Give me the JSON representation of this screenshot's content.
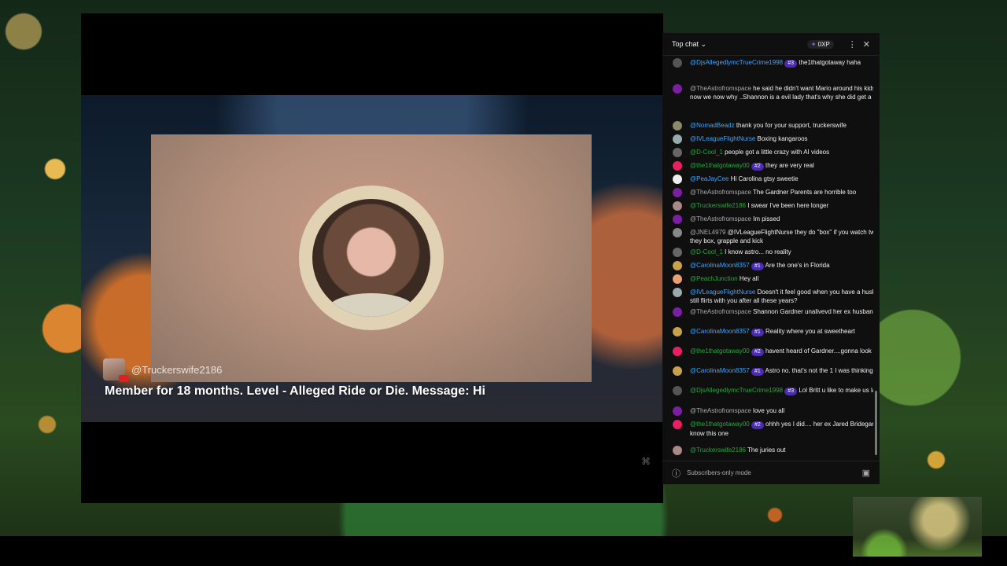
{
  "stream": {
    "member_handle": "@Truckerswife2186",
    "member_message": "Member for 18 months. Level - Alleged Ride or Die. Message: Hi"
  },
  "chat": {
    "header": {
      "title": "Top chat",
      "xp": "0XP"
    },
    "footer": {
      "mode": "Subscribers-only mode"
    },
    "messages": [
      {
        "author": "@DjsAllegedlymcTrueCrime1998",
        "badge": "#3",
        "text": "the1thatgotaway haha",
        "color": "#3ea6ff",
        "av": "#555"
      },
      {
        "author": "@TheAstrofromspace",
        "badge": "",
        "text": "he said he didn't want Mario around his kids and now we now why ..Shannon is a evil lady that's why she did get a bond",
        "color": "#aaaaaa",
        "av": "#7b1fa2"
      },
      {
        "author": "@NomadBeadz",
        "badge": "",
        "text": "thank you for your support, truckerswife",
        "color": "#3ea6ff",
        "av": "#8a8a6a"
      },
      {
        "author": "@IVLeagueFlightNurse",
        "badge": "",
        "text": "Boxing kangaroos",
        "color": "#3ea6ff",
        "av": "#9aa"
      },
      {
        "author": "@D-Cool_1",
        "badge": "",
        "text": "people got a little crazy with AI videos",
        "color": "#2ba640",
        "av": "#666"
      },
      {
        "author": "@the1thatgotaway00",
        "badge": "#2",
        "text": "they are very real",
        "color": "#2ba640",
        "av": "#e91e63"
      },
      {
        "author": "@PeaJayCee",
        "badge": "",
        "text": "Hi Carolina gtsy sweetie",
        "color": "#3ea6ff",
        "av": "#eee"
      },
      {
        "author": "@TheAstrofromspace",
        "badge": "",
        "text": "The Gardner Parents are horrible too",
        "color": "#aaaaaa",
        "av": "#7b1fa2"
      },
      {
        "author": "@Truckerswife2186",
        "badge": "",
        "text": "I swear I've been here longer",
        "color": "#2ba640",
        "av": "#a88"
      },
      {
        "author": "@TheAstrofromspace",
        "badge": "",
        "text": "Im pissed",
        "color": "#aaaaaa",
        "av": "#7b1fa2"
      },
      {
        "author": "@JNEL4979",
        "badge": "",
        "text": "@IVLeagueFlightNurse they do \"box\" if you watch two fight they box, grapple and kick",
        "color": "#aaaaaa",
        "av": "#888"
      },
      {
        "author": "@D-Cool_1",
        "badge": "",
        "text": "I know astro... no reality",
        "color": "#2ba640",
        "av": "#666"
      },
      {
        "author": "@CarolinaMoon8357",
        "badge": "#1",
        "text": "Are the one's in Florida",
        "color": "#3ea6ff",
        "av": "#c9a14a"
      },
      {
        "author": "@PeachJunction",
        "badge": "",
        "text": "Hey all",
        "color": "#2ba640",
        "av": "#e8a070"
      },
      {
        "author": "@IVLeagueFlightNurse",
        "badge": "",
        "text": "Doesn't it feel good when you have a husband that still flirts with you after all these years?",
        "color": "#3ea6ff",
        "av": "#9aa"
      },
      {
        "author": "@TheAstrofromspace",
        "badge": "",
        "text": "Shannon Gardner unalivevd her ex husband Jared",
        "color": "#aaaaaa",
        "av": "#7b1fa2"
      },
      {
        "author": "@CarolinaMoon8357",
        "badge": "#1",
        "text": "Reality where you at sweetheart",
        "color": "#3ea6ff",
        "av": "#c9a14a"
      },
      {
        "author": "@the1thatgotaway00",
        "badge": "#2",
        "text": "havent heard of Gardner....gonna look her up",
        "color": "#2ba640",
        "av": "#e91e63"
      },
      {
        "author": "@CarolinaMoon8357",
        "badge": "#1",
        "text": "Astro no. that's not the 1 I was thinking",
        "color": "#3ea6ff",
        "av": "#c9a14a"
      },
      {
        "author": "@DjsAllegedlymcTrueCrime1998",
        "badge": "#3",
        "text": "Lol Britt u like to make us laugh",
        "color": "#2ba640",
        "av": "#555"
      },
      {
        "author": "@TheAstrofromspace",
        "badge": "",
        "text": "love you all",
        "color": "#aaaaaa",
        "av": "#7b1fa2"
      },
      {
        "author": "@the1thatgotaway00",
        "badge": "#2",
        "text": "ohhh yes I did.... her ex Jared Bridegan...yes I know this one",
        "color": "#2ba640",
        "av": "#e91e63"
      },
      {
        "author": "@Truckerswife2186",
        "badge": "",
        "text": "The juries out",
        "color": "#2ba640",
        "av": "#a88"
      }
    ]
  }
}
